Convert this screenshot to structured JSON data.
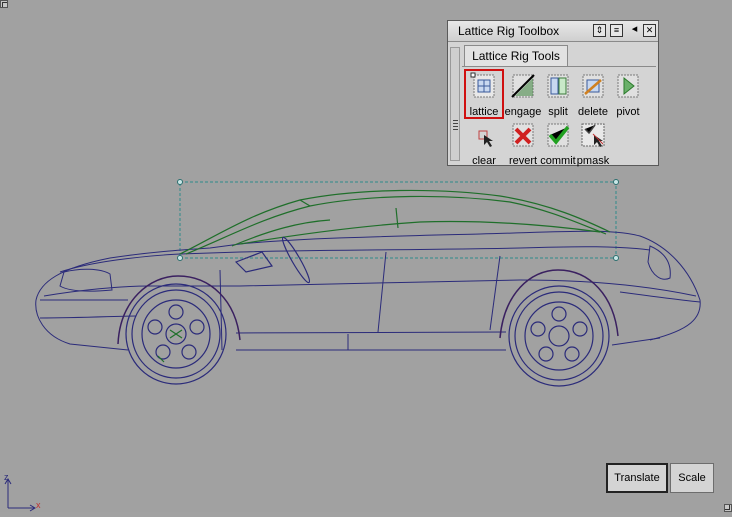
{
  "window": {
    "title": "Lattice Rig Toolbox",
    "buttons": [
      "move-icon",
      "list-icon",
      "collapse-left-icon",
      "close-icon"
    ],
    "tab": "Lattice Rig Tools"
  },
  "tools": [
    {
      "label": "lattice",
      "icon": "lattice-icon",
      "selected": true
    },
    {
      "label": "engage",
      "icon": "engage-icon",
      "selected": false
    },
    {
      "label": "split",
      "icon": "split-icon",
      "selected": false
    },
    {
      "label": "delete",
      "icon": "delete-icon",
      "selected": false
    },
    {
      "label": "pivot",
      "icon": "pivot-icon",
      "selected": false
    },
    {
      "label": "clear",
      "icon": "clear-icon",
      "selected": false
    },
    {
      "label": "revert",
      "icon": "revert-icon",
      "selected": false
    },
    {
      "label": "commit",
      "icon": "commit-icon",
      "selected": false
    },
    {
      "label": "pmask",
      "icon": "pmask-icon",
      "selected": false
    }
  ],
  "viewport": {
    "background": "#a1a1a1",
    "wire_colors": {
      "body": "#2b2b7a",
      "dark": "#3a2060",
      "selection": "#1f6f2a",
      "lattice": "#2f8a8a"
    }
  },
  "mode_buttons": {
    "translate": "Translate",
    "scale": "Scale",
    "active": "Translate"
  },
  "axis": {
    "labels": [
      "z",
      "x"
    ]
  }
}
